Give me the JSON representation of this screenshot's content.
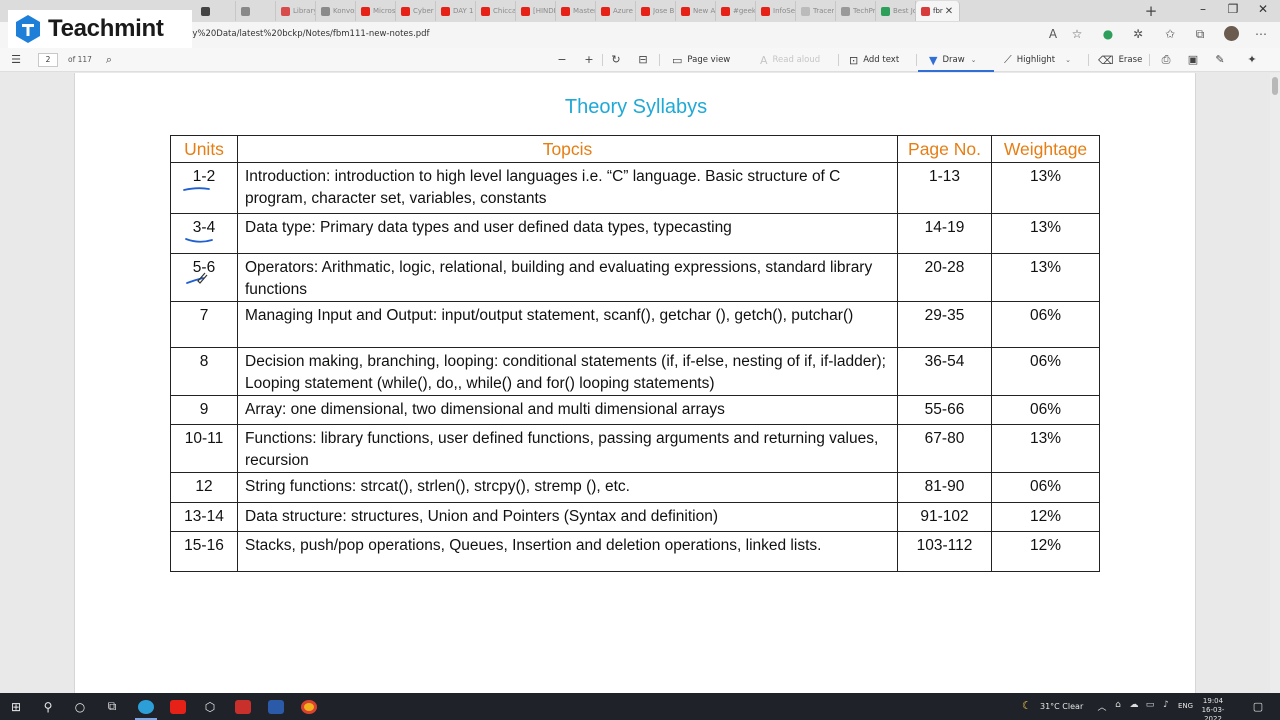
{
  "browser": {
    "tabs": [
      {
        "title": "",
        "color": "#444444"
      },
      {
        "title": "",
        "color": "#888888"
      },
      {
        "title": "Library",
        "color": "#d84b4b"
      },
      {
        "title": "Konvos",
        "color": "#8a8a8a"
      },
      {
        "title": "Microso",
        "color": "#e62117"
      },
      {
        "title": "Cyber S",
        "color": "#e62117"
      },
      {
        "title": "DAY 1",
        "color": "#e62117"
      },
      {
        "title": "Chiccar",
        "color": "#e62117"
      },
      {
        "title": "[HINDI]",
        "color": "#e62117"
      },
      {
        "title": "Master",
        "color": "#e62117"
      },
      {
        "title": "Azure",
        "color": "#e62117"
      },
      {
        "title": "Jose Bra",
        "color": "#e62117"
      },
      {
        "title": "New AC",
        "color": "#e62117"
      },
      {
        "title": "#geek",
        "color": "#e62117"
      },
      {
        "title": "InfoSec",
        "color": "#e62117"
      },
      {
        "title": "Tracer",
        "color": "#bbbbbb"
      },
      {
        "title": "TechPri",
        "color": "#999999"
      },
      {
        "title": "Best Jot",
        "color": "#2e9e5b"
      }
    ],
    "active_tab": {
      "title": "fbr",
      "color": "#d83b3b"
    },
    "new_tab_icon": "+",
    "url": "ly%20Data/latest%20bckp/Notes/fbm111-new-notes.pdf"
  },
  "logo": {
    "text": "Teachmint",
    "color": "#1e7fd9"
  },
  "pdf_toolbar": {
    "page_current": "2",
    "page_total": "of 117",
    "page_view_label": "Page view",
    "read_aloud_label": "Read aloud",
    "add_text_label": "Add text",
    "draw_label": "Draw",
    "highlight_label": "Highlight",
    "erase_label": "Erase"
  },
  "document": {
    "title": "Theory Syllabys",
    "table": {
      "headers": [
        "Units",
        "Topcis",
        "Page No.",
        "Weightage"
      ],
      "rows": [
        {
          "unit": "1-2",
          "topic": "Introduction: introduction to high level languages i.e. “C” language. Basic structure of C program, character set, variables, constants",
          "pages": "1-13",
          "weight": "13%"
        },
        {
          "unit": "3-4",
          "topic": "Data type: Primary data types and user defined data types, typecasting",
          "pages": "14-19",
          "weight": "13%"
        },
        {
          "unit": "5-6",
          "topic": "Operators: Arithmatic, logic, relational, building and evaluating expressions, standard library functions",
          "pages": "20-28",
          "weight": "13%"
        },
        {
          "unit": "7",
          "topic": "Managing Input and Output: input/output statement, scanf(), getchar (), getch(), putchar()",
          "pages": "29-35",
          "weight": "06%"
        },
        {
          "unit": "8",
          "topic": "Decision making, branching, looping: conditional statements (if, if-else, nesting of if, if-ladder); Looping statement (while(), do,, while() and for() looping statements)",
          "pages": "36-54",
          "weight": "06%"
        },
        {
          "unit": "9",
          "topic": "Array: one dimensional, two dimensional and multi dimensional arrays",
          "pages": "55-66",
          "weight": "06%"
        },
        {
          "unit": "10-11",
          "topic": "Functions: library functions, user defined functions, passing arguments and returning values, recursion",
          "pages": "67-80",
          "weight": "13%"
        },
        {
          "unit": "12",
          "topic": "String functions: strcat(), strlen(), strcpy(), stremp (), etc.",
          "pages": "81-90",
          "weight": "06%"
        },
        {
          "unit": "13-14",
          "topic": "Data structure: structures, Union and Pointers (Syntax and definition)",
          "pages": "91-102",
          "weight": "12%"
        },
        {
          "unit": "15-16",
          "topic": "Stacks, push/pop operations, Queues, Insertion and deletion operations, linked lists.",
          "pages": "103-112",
          "weight": "12%"
        }
      ]
    },
    "ink_color": "#1f5fd0"
  },
  "taskbar": {
    "weather": "31°C  Clear",
    "language": "ENG",
    "time": "19:04",
    "date": "16-03-2022"
  }
}
